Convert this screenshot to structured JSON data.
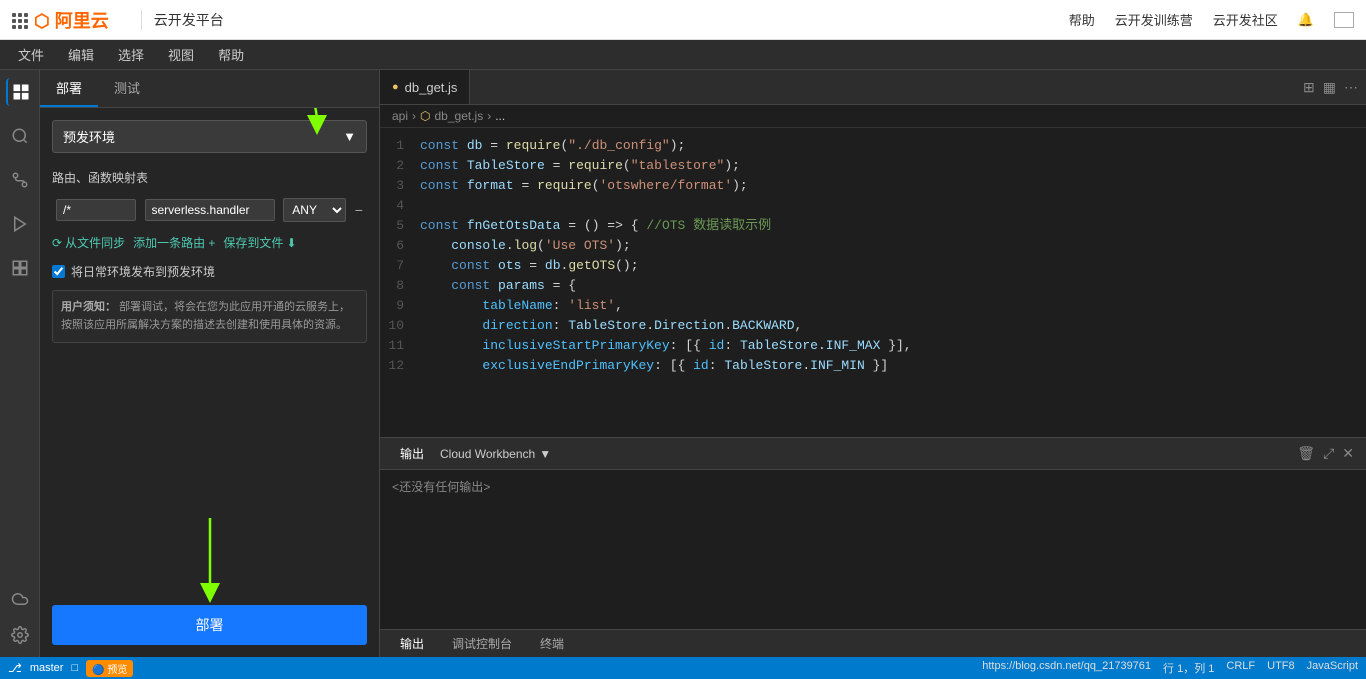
{
  "app": {
    "title": "云开发平台",
    "logo_text": "阿里云",
    "nav_items": [
      "帮助",
      "云开发训练营",
      "云开发社区"
    ]
  },
  "menu": {
    "items": [
      "文件",
      "编辑",
      "选择",
      "视图",
      "帮助"
    ]
  },
  "sidebar": {
    "tabs": [
      "部署",
      "测试"
    ],
    "active_tab": "部署",
    "env_label": "预发环境",
    "section_route": "路由、函数映射表",
    "route_path": "/*",
    "route_handler": "serverless.handler",
    "route_method": "ANY",
    "action_sync": "从文件同步",
    "action_add": "添加一条路由 +",
    "action_save": "保存到文件",
    "checkbox_label": "将日常环境发布到预发环境",
    "notice_prefix": "用户须知：",
    "notice_text": "部署调试，将会在您为此应用开通的云服务上，按照该应用所属解决方案的描述去创建和使用具体的资源。",
    "deploy_btn": "部署"
  },
  "editor": {
    "tab_file": "db_get.js",
    "breadcrumb": [
      "api",
      "db_get.js",
      "..."
    ],
    "lines": [
      {
        "num": 1,
        "text": "const db = require('./db_config');"
      },
      {
        "num": 2,
        "text": "const TableStore = require('tablestore');"
      },
      {
        "num": 3,
        "text": "const format = require('otswhere/format');"
      },
      {
        "num": 4,
        "text": ""
      },
      {
        "num": 5,
        "text": "const fnGetOtsData = () => { //OTS 数据读取示例"
      },
      {
        "num": 6,
        "text": "    console.log('Use OTS');"
      },
      {
        "num": 7,
        "text": "    const ots = db.getOTS();"
      },
      {
        "num": 8,
        "text": "    const params = {"
      },
      {
        "num": 9,
        "text": "        tableName: 'list',"
      },
      {
        "num": 10,
        "text": "        direction: TableStore.Direction.BACKWARD,"
      },
      {
        "num": 11,
        "text": "        inclusiveStartPrimaryKey: [{ id: TableStore.INF_MAX }],"
      },
      {
        "num": 12,
        "text": "        exclusiveEndPrimaryKey: [{ id: TableStore.INF_MIN }]"
      }
    ]
  },
  "output": {
    "panel_label": "输出",
    "workbench_label": "Cloud Workbench",
    "empty_text": "<还没有任何输出>",
    "bottom_tabs": [
      "输出",
      "调试控制台",
      "终端"
    ]
  },
  "statusbar": {
    "branch": "master",
    "preview_label": "预览",
    "position": "行 1，列 1",
    "encoding": "CRLF",
    "charset": "UTF8",
    "language": "JavaScript",
    "link": "https://blog.csdn.net/qq_21739761"
  }
}
